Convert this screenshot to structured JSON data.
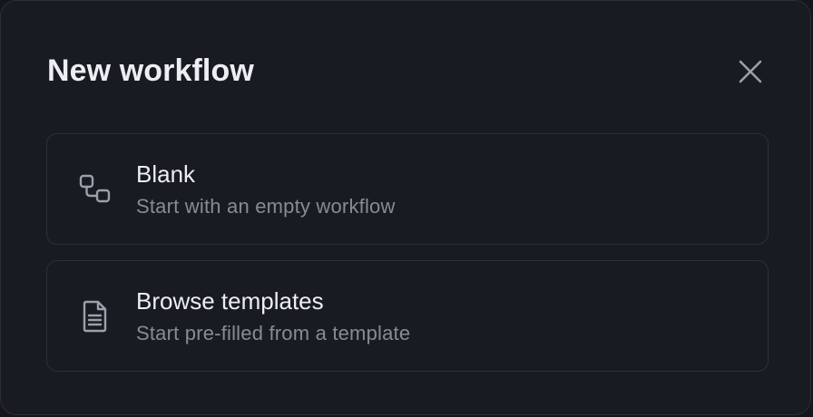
{
  "dialog": {
    "title": "New workflow",
    "close_icon": "close-icon",
    "options": [
      {
        "icon": "nodes-icon",
        "title": "Blank",
        "description": "Start with an empty workflow"
      },
      {
        "icon": "document-icon",
        "title": "Browse templates",
        "description": "Start pre-filled from a template"
      }
    ]
  },
  "colors": {
    "background": "#181b22",
    "border": "#2c3039",
    "title_text": "#eceef2",
    "muted_text": "#878b94",
    "icon": "#9ba0a9"
  }
}
